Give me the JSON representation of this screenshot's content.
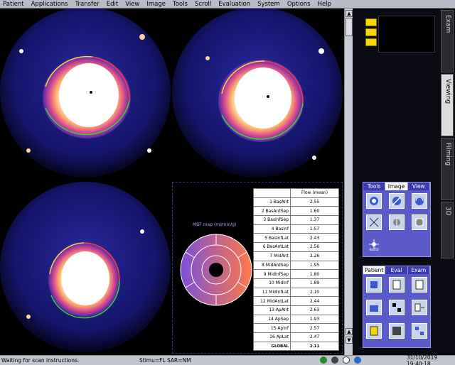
{
  "menu": [
    "Patient",
    "Applications",
    "Transfer",
    "Edit",
    "View",
    "Image",
    "Tools",
    "Scroll",
    "Evaluation",
    "System",
    "Options",
    "Help"
  ],
  "side_tabs": [
    "Exam",
    "Viewing",
    "Filming",
    "3D"
  ],
  "tools_group": {
    "tabs": [
      "Tools",
      "Image",
      "View"
    ],
    "active_tab": "Image",
    "auto_label": "auto"
  },
  "patient_group": {
    "tabs": [
      "Patient",
      "Eval",
      "Exam"
    ],
    "active_tab": "Patient"
  },
  "analysis": {
    "map_title": "MBF map (ml/min/g)",
    "table_header": "Flow (mean)",
    "rows": [
      {
        "segment": "1 BasAnt",
        "value": "2.55"
      },
      {
        "segment": "2 BasAntSep",
        "value": "1.60"
      },
      {
        "segment": "3 BasInfSep",
        "value": "1.37"
      },
      {
        "segment": "4 BasInf",
        "value": "1.57"
      },
      {
        "segment": "5 BasInfLat",
        "value": "2.43"
      },
      {
        "segment": "6 BasAntLat",
        "value": "2.56"
      },
      {
        "segment": "7 MidAnt",
        "value": "2.26"
      },
      {
        "segment": "8 MidAntSep",
        "value": "1.95"
      },
      {
        "segment": "9 MidInfSep",
        "value": "1.80"
      },
      {
        "segment": "10 MidInf",
        "value": "1.89"
      },
      {
        "segment": "11 MidInfLat",
        "value": "2.10"
      },
      {
        "segment": "12 MidAntLat",
        "value": "2.44"
      },
      {
        "segment": "13 ApAnt",
        "value": "2.63"
      },
      {
        "segment": "14 ApSep",
        "value": "1.93"
      },
      {
        "segment": "15 ApInf",
        "value": "2.57"
      },
      {
        "segment": "16 ApLat",
        "value": "2.47"
      },
      {
        "segment": "GLOBAL",
        "value": "2.11"
      }
    ],
    "colors": {
      "low": "#7b4fd6",
      "high": "#ff7a4a"
    }
  },
  "status": {
    "message": "Waiting for scan instructions.",
    "params": "Stimu=FL SAR=NM",
    "clock": "31/10/2019 19:40:18"
  }
}
